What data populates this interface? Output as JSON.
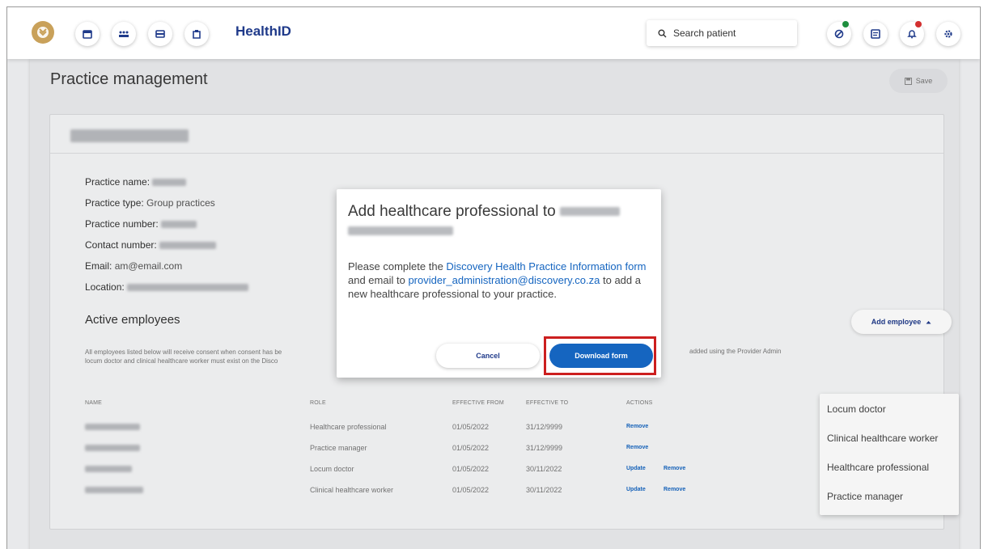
{
  "header": {
    "brand": "HealthID",
    "search_placeholder": "Search patient",
    "nav_icons": [
      "calendar-icon",
      "people-icon",
      "card-icon",
      "clipboard-icon"
    ],
    "right_icons": [
      "consent-icon",
      "messages-icon",
      "notifications-icon",
      "settings-icon"
    ],
    "colors": {
      "brand": "#1f3a8a",
      "accent": "#1565c0",
      "logo": "#c9a15a",
      "status_green": "#1e8e3e",
      "alert_red": "#d32f2f"
    }
  },
  "page": {
    "title": "Practice management",
    "save_label": "Save"
  },
  "practice": {
    "name_label": "Practice name:",
    "type_label": "Practice type:",
    "type_value": "Group practices",
    "number_label": "Practice number:",
    "contact_label": "Contact number:",
    "email_label": "Email:",
    "email_value": "am@email.com",
    "location_label": "Location:"
  },
  "employees": {
    "heading": "Active employees",
    "add_button": "Add employee",
    "note_line1": "All employees listed below will receive consent when consent has be",
    "note_line2": "locum doctor and clinical healthcare worker must exist on the Disco",
    "note_right": "added using the Provider Admin",
    "columns": [
      "NAME",
      "ROLE",
      "EFFECTIVE FROM",
      "EFFECTIVE TO",
      "ACTIONS"
    ],
    "rows": [
      {
        "role": "Healthcare professional",
        "from": "01/05/2022",
        "to": "31/12/9999",
        "actions": [
          "Remove"
        ]
      },
      {
        "role": "Practice manager",
        "from": "01/05/2022",
        "to": "31/12/9999",
        "actions": [
          "Remove"
        ]
      },
      {
        "role": "Locum doctor",
        "from": "01/05/2022",
        "to": "30/11/2022",
        "actions": [
          "Update",
          "Remove"
        ]
      },
      {
        "role": "Clinical healthcare worker",
        "from": "01/05/2022",
        "to": "30/11/2022",
        "actions": [
          "Update",
          "Remove"
        ]
      }
    ],
    "dropdown_options": [
      "Locum doctor",
      "Clinical healthcare worker",
      "Healthcare professional",
      "Practice manager"
    ]
  },
  "dialog": {
    "title": "Add healthcare professional to",
    "body_pre": "Please complete the ",
    "body_link": "Discovery Health Practice Information form",
    "body_mid": " and email to ",
    "body_email": "provider_administration@discovery.co.za",
    "body_post": " to add a new healthcare professional to your practice.",
    "cancel_label": "Cancel",
    "download_label": "Download form",
    "highlight_color": "#cc1f1f"
  }
}
